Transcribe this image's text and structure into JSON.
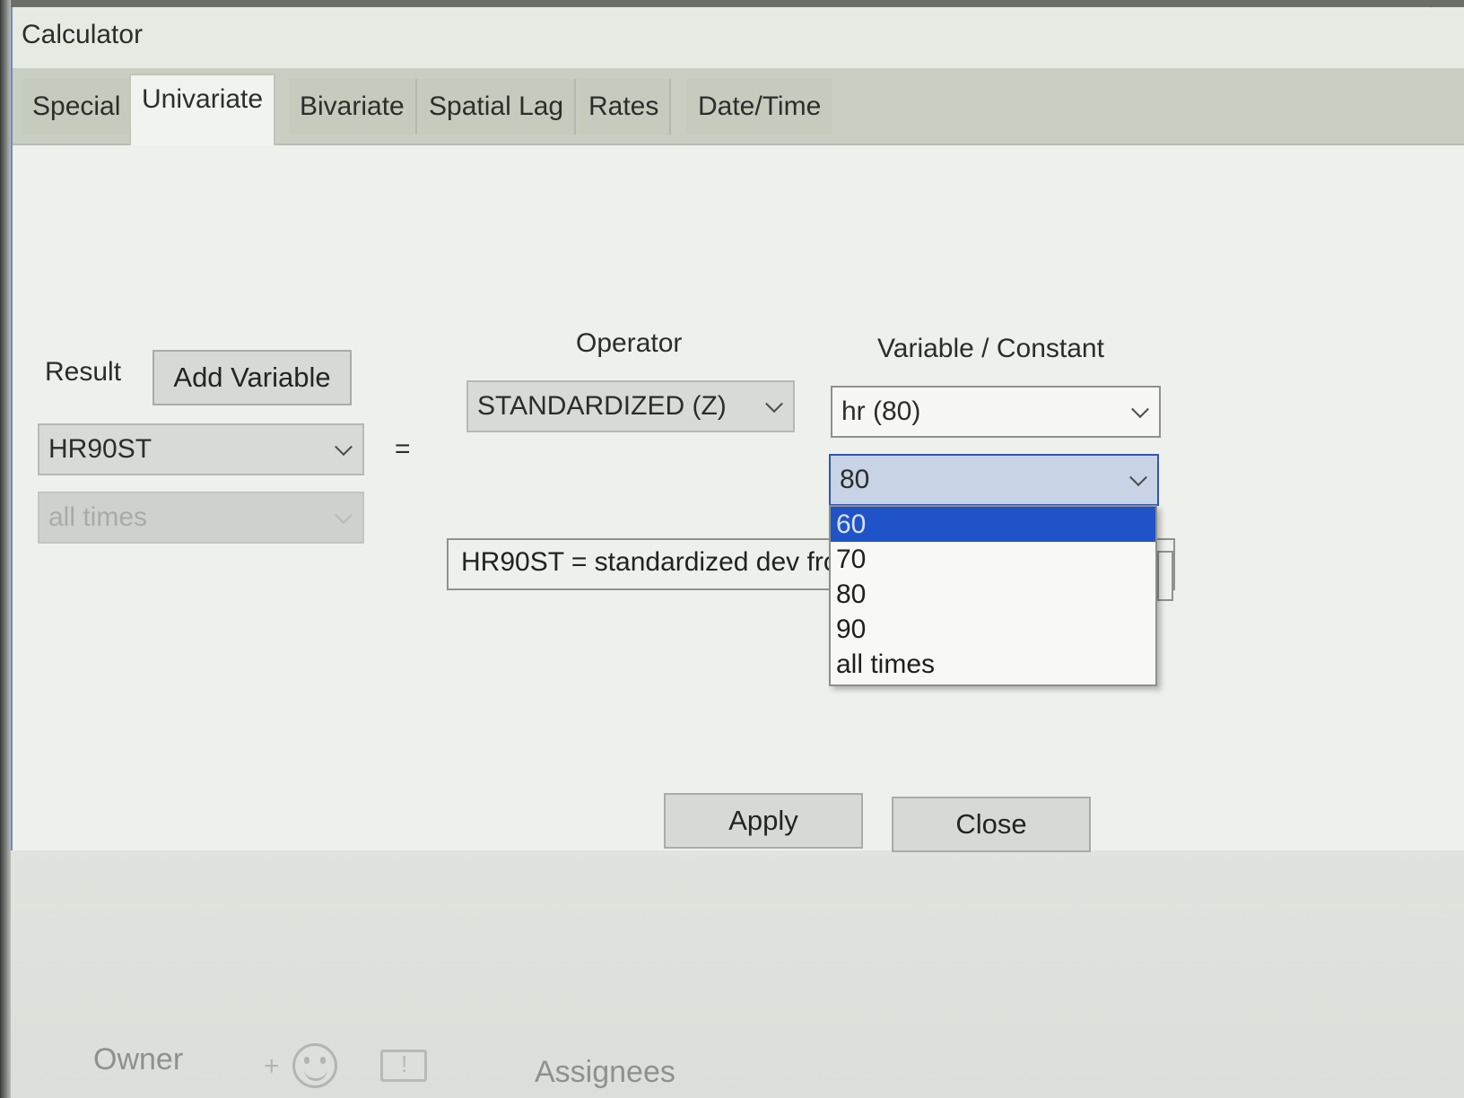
{
  "window": {
    "title": "Calculator"
  },
  "tabs": [
    {
      "label": "Special",
      "active": false
    },
    {
      "label": "Univariate",
      "active": true
    },
    {
      "label": "Bivariate",
      "active": false
    },
    {
      "label": "Spatial Lag",
      "active": false
    },
    {
      "label": "Rates",
      "active": false
    },
    {
      "label": "Date/Time",
      "active": false
    }
  ],
  "form": {
    "result_label": "Result",
    "add_variable_label": "Add Variable",
    "result_value": "HR90ST",
    "result_time_value": "all times",
    "equals": "=",
    "operator_label": "Operator",
    "operator_value": "STANDARDIZED (Z)",
    "variable_label": "Variable / Constant",
    "variable_value": "hr (80)",
    "time_value": "80",
    "formula_text": "HR90ST = standardized dev fro"
  },
  "time_dropdown": {
    "options": [
      "60",
      "70",
      "80",
      "90",
      "all times"
    ],
    "highlighted": "60"
  },
  "buttons": {
    "apply": "Apply",
    "close": "Close"
  },
  "background": {
    "owner_label": "Owner",
    "assignees_label": "Assignees",
    "plus": "+"
  },
  "colors": {
    "selection": "#2053c7",
    "focus_border": "#2f56b0",
    "window_border": "#6b8bc9"
  },
  "icons": [
    "chevron-down-icon",
    "smiley-icon",
    "comment-icon",
    "star-icon"
  ]
}
